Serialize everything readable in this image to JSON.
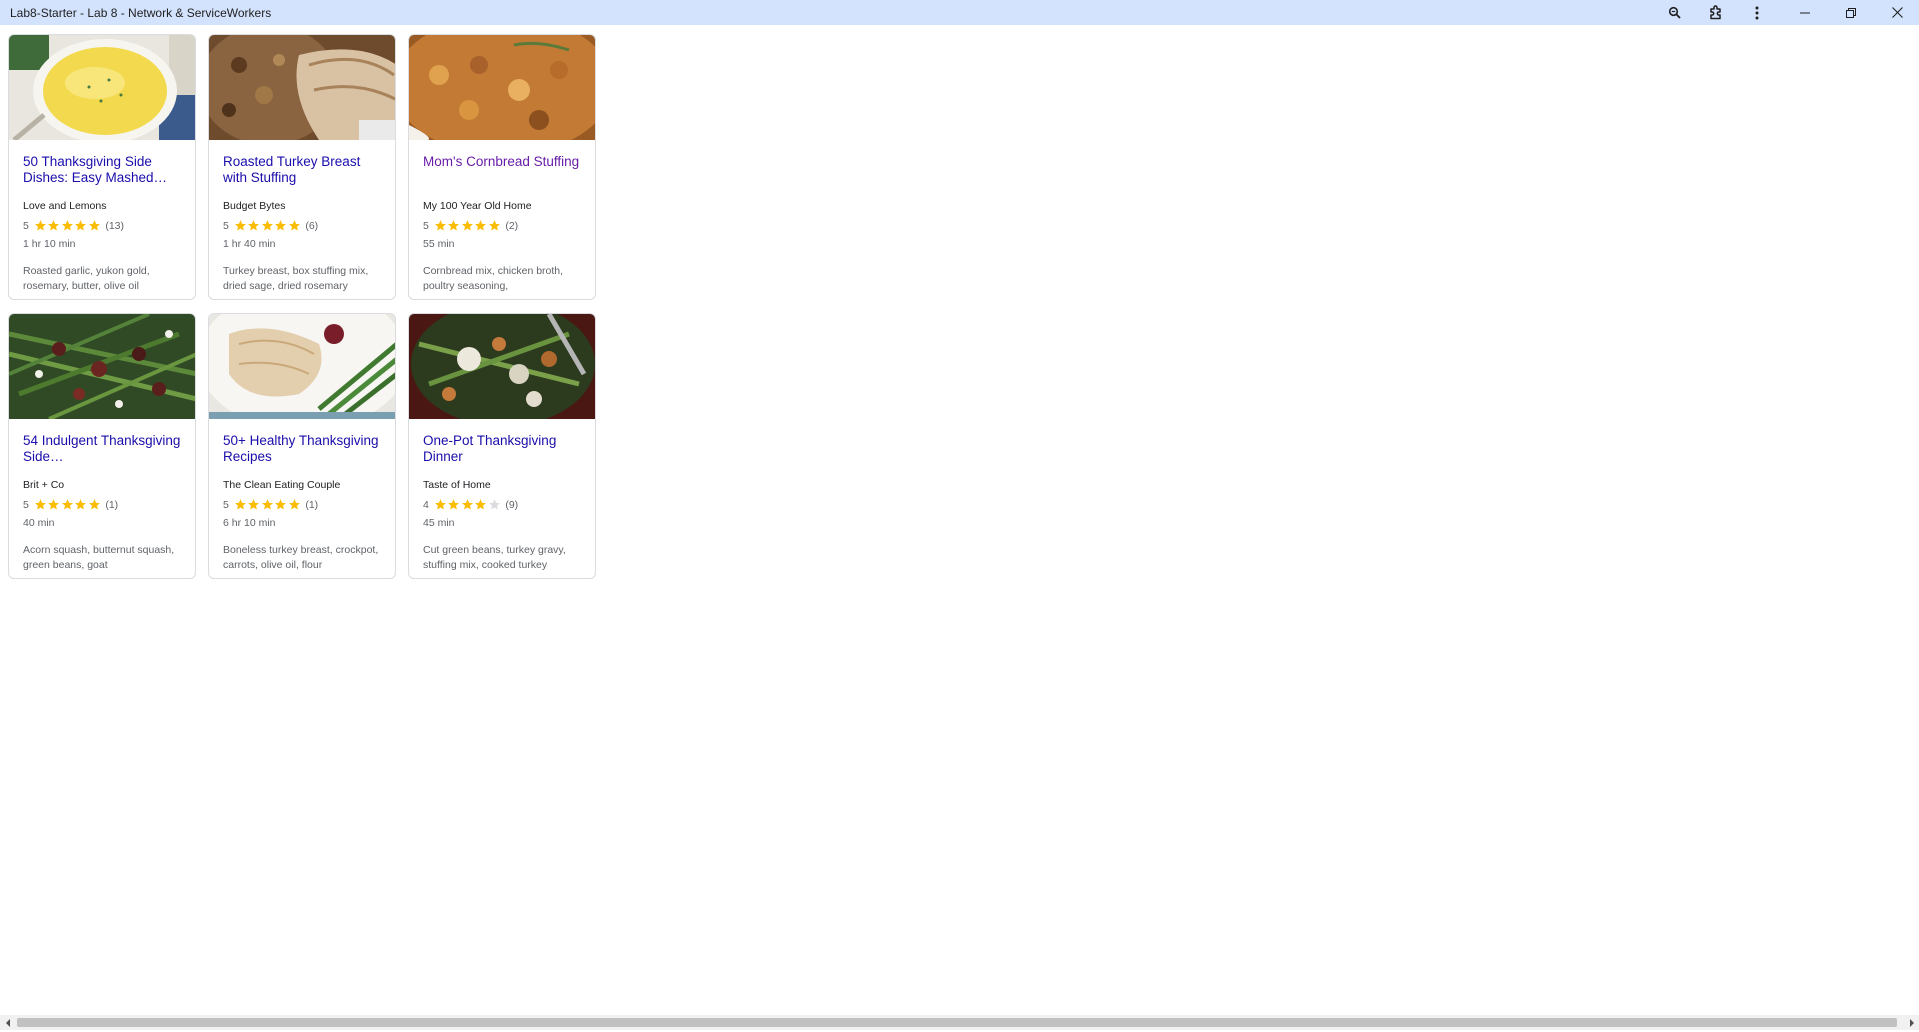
{
  "window": {
    "title": "Lab8-Starter - Lab 8 - Network & ServiceWorkers",
    "buttons": [
      {
        "name": "zoom-icon"
      },
      {
        "name": "extensions-icon"
      },
      {
        "name": "more-menu-icon"
      },
      {
        "name": "minimize-icon"
      },
      {
        "name": "restore-icon"
      },
      {
        "name": "close-icon"
      }
    ]
  },
  "colors": {
    "titlebar": "#d3e3fd",
    "link": "#1a0dab",
    "visited_link": "#681da8",
    "star_filled": "#fbbc04",
    "star_empty": "#dadce0"
  },
  "recipes": [
    {
      "title": "50 Thanksgiving Side Dishes: Easy Mashed…",
      "source": "Love and Lemons",
      "rating": "5",
      "stars": 5,
      "reviews": "(13)",
      "time": "1 hr 10 min",
      "ingredients": "Roasted garlic, yukon gold, rosemary, butter, olive oil",
      "image": "mashed-potatoes-photo",
      "visited": false
    },
    {
      "title": "Roasted Turkey Breast with Stuffing",
      "source": "Budget Bytes",
      "rating": "5",
      "stars": 5,
      "reviews": "(6)",
      "time": "1 hr 40 min",
      "ingredients": "Turkey breast, box stuffing mix, dried sage, dried rosemary",
      "image": "turkey-stuffing-photo",
      "visited": false
    },
    {
      "title": "Mom's Cornbread Stuffing",
      "source": "My 100 Year Old Home",
      "rating": "5",
      "stars": 5,
      "reviews": "(2)",
      "time": "55 min",
      "ingredients": "Cornbread mix, chicken broth, poultry seasoning,",
      "image": "cornbread-stuffing-photo",
      "visited": true
    },
    {
      "title": "54 Indulgent Thanksgiving Side…",
      "source": "Brit + Co",
      "rating": "5",
      "stars": 5,
      "reviews": "(1)",
      "time": "40 min",
      "ingredients": "Acorn squash, butternut squash, green beans, goat",
      "image": "green-beans-photo",
      "visited": false
    },
    {
      "title": "50+ Healthy Thanksgiving Recipes",
      "source": "The Clean Eating Couple",
      "rating": "5",
      "stars": 5,
      "reviews": "(1)",
      "time": "6 hr 10 min",
      "ingredients": "Boneless turkey breast, crockpot, carrots, olive oil, flour",
      "image": "turkey-plate-photo",
      "visited": false
    },
    {
      "title": "One-Pot Thanksgiving Dinner",
      "source": "Taste of Home",
      "rating": "4",
      "stars": 4,
      "reviews": "(9)",
      "time": "45 min",
      "ingredients": "Cut green beans, turkey gravy, stuffing mix, cooked turkey",
      "image": "one-pot-dinner-photo",
      "visited": false
    }
  ]
}
